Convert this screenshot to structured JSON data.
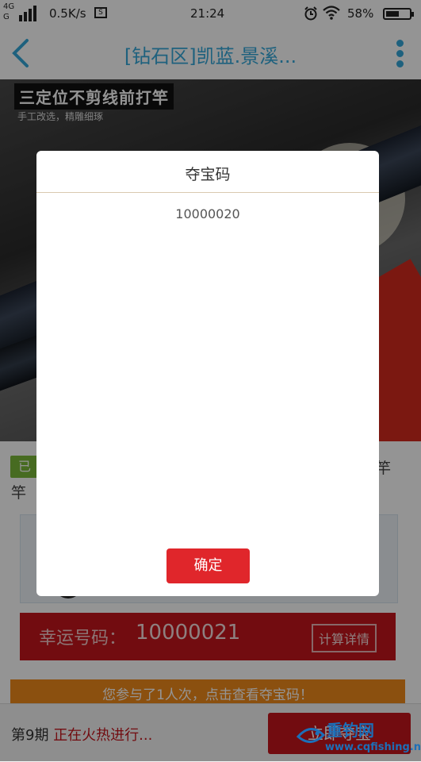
{
  "status_bar": {
    "network": "4G",
    "network2": "G",
    "speed": "0.5K/s",
    "sim_icon": "S",
    "time": "21:24",
    "battery_percent": "58%",
    "battery_level": 0.58,
    "icons": [
      "signal-icon",
      "screenshot-icon",
      "alarm-icon",
      "wifi-icon",
      "battery-icon"
    ]
  },
  "nav": {
    "title": "[钻石区]凯蓝.景溪...",
    "back_icon": "back-arrow-icon",
    "menu_icon": "more-vertical-icon",
    "accent_color": "#35a8d9"
  },
  "banner": {
    "tagline": "三定位不剪线前打竿",
    "subline": "手工改选，精雕细琢"
  },
  "product": {
    "status_tag": "已",
    "name_part1": "竿",
    "name_part2": "竿"
  },
  "lucky": {
    "label": "幸运号码：",
    "number": "10000021",
    "calc_button": "计算详情"
  },
  "participate": {
    "text": "您参与了1人次，点击查看夺宝码！"
  },
  "bottom": {
    "period": "第9期",
    "period_status": "正在火热进行...",
    "join_button": "立即夺宝"
  },
  "watermark": {
    "name": "重钓网",
    "url": "www.cqfishing.net"
  },
  "modal": {
    "title": "夺宝码",
    "code": "10000020",
    "confirm": "确定"
  }
}
